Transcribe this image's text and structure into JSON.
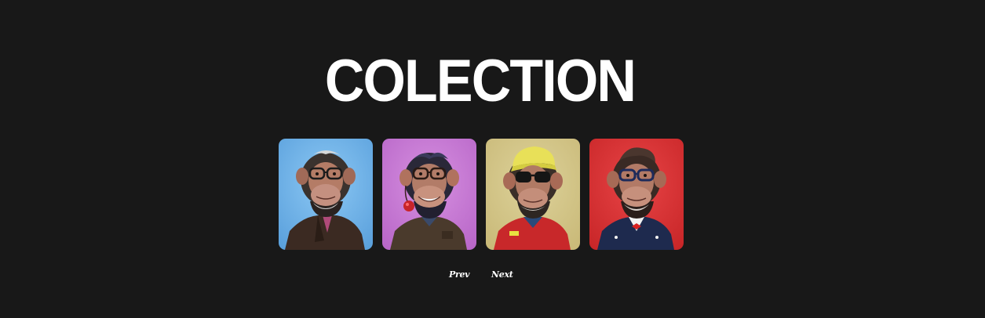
{
  "section": {
    "title": "COLECTION"
  },
  "gallery": {
    "items": [
      {
        "subject": "chimpanzee-glasses-leather-jacket",
        "background": "#73b6ea",
        "outfit": "#3b2a22"
      },
      {
        "subject": "chimpanzee-headphones-brown-jacket",
        "background": "#c879d4",
        "outfit": "#4a3a2c"
      },
      {
        "subject": "chimpanzee-yellow-cap-sunglasses",
        "background": "#d2c58a",
        "outfit": "#c8282a"
      },
      {
        "subject": "chimpanzee-glasses-navy-jacket",
        "background": "#dc3436",
        "outfit": "#1e2a4e"
      }
    ]
  },
  "pager": {
    "prev_label": "Prev",
    "next_label": "Next"
  },
  "colors": {
    "page_background": "#181818",
    "text": "#ffffff"
  }
}
